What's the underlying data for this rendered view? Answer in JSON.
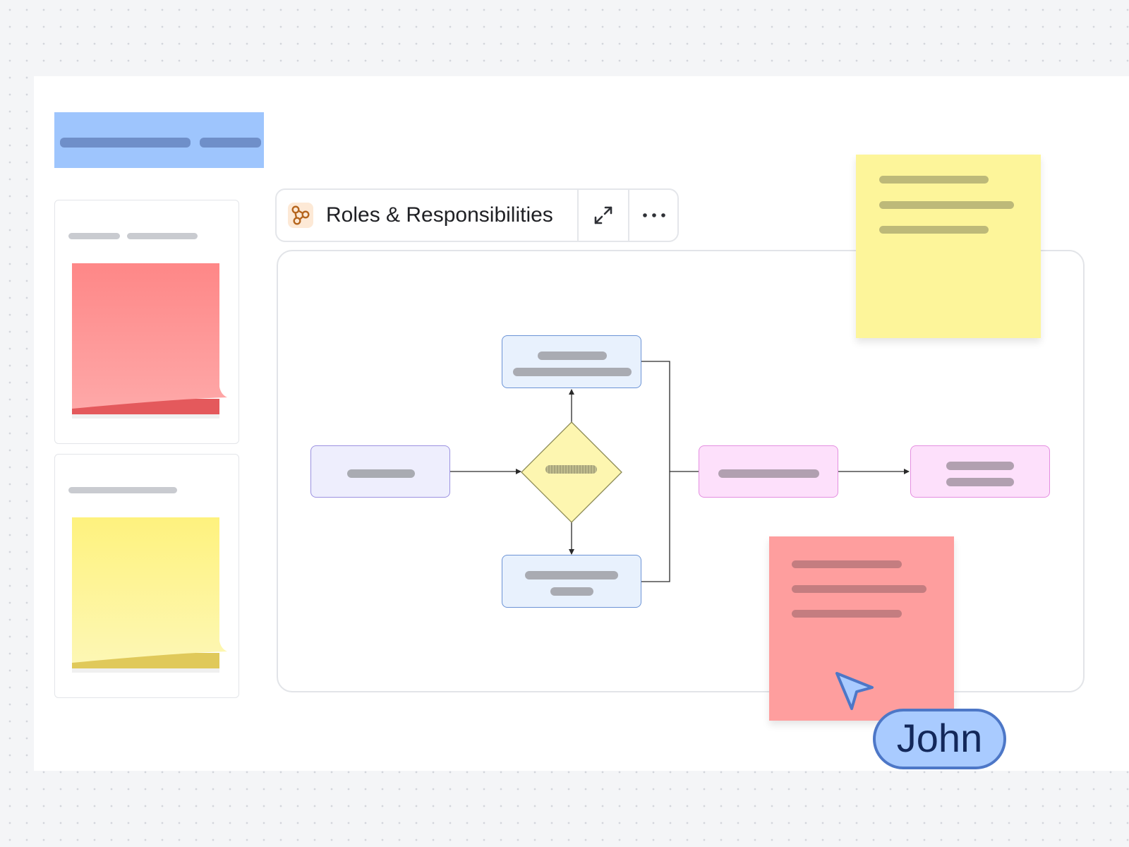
{
  "frame": {
    "title": "Roles & Responsibilities",
    "icon": "flowchart-icon",
    "actions": [
      "expand-icon",
      "more-options-icon"
    ]
  },
  "collaborator": {
    "name": "John",
    "cursor_icon": "pointer-cursor-icon"
  },
  "colors": {
    "board_background": "#f4f5f7",
    "canvas": "#ffffff",
    "banner_blue": "#9ec5fd",
    "sticky_yellow": "#fdf59a",
    "sticky_red": "#fe9e9e",
    "collaborator_badge": "#a9cbff",
    "collaborator_border": "#4d77c7",
    "decision_yellow": "#fdf6b0",
    "node_blue": "#e8f1fd",
    "node_lavender": "#eeeefd",
    "node_pink": "#fde0fb"
  }
}
